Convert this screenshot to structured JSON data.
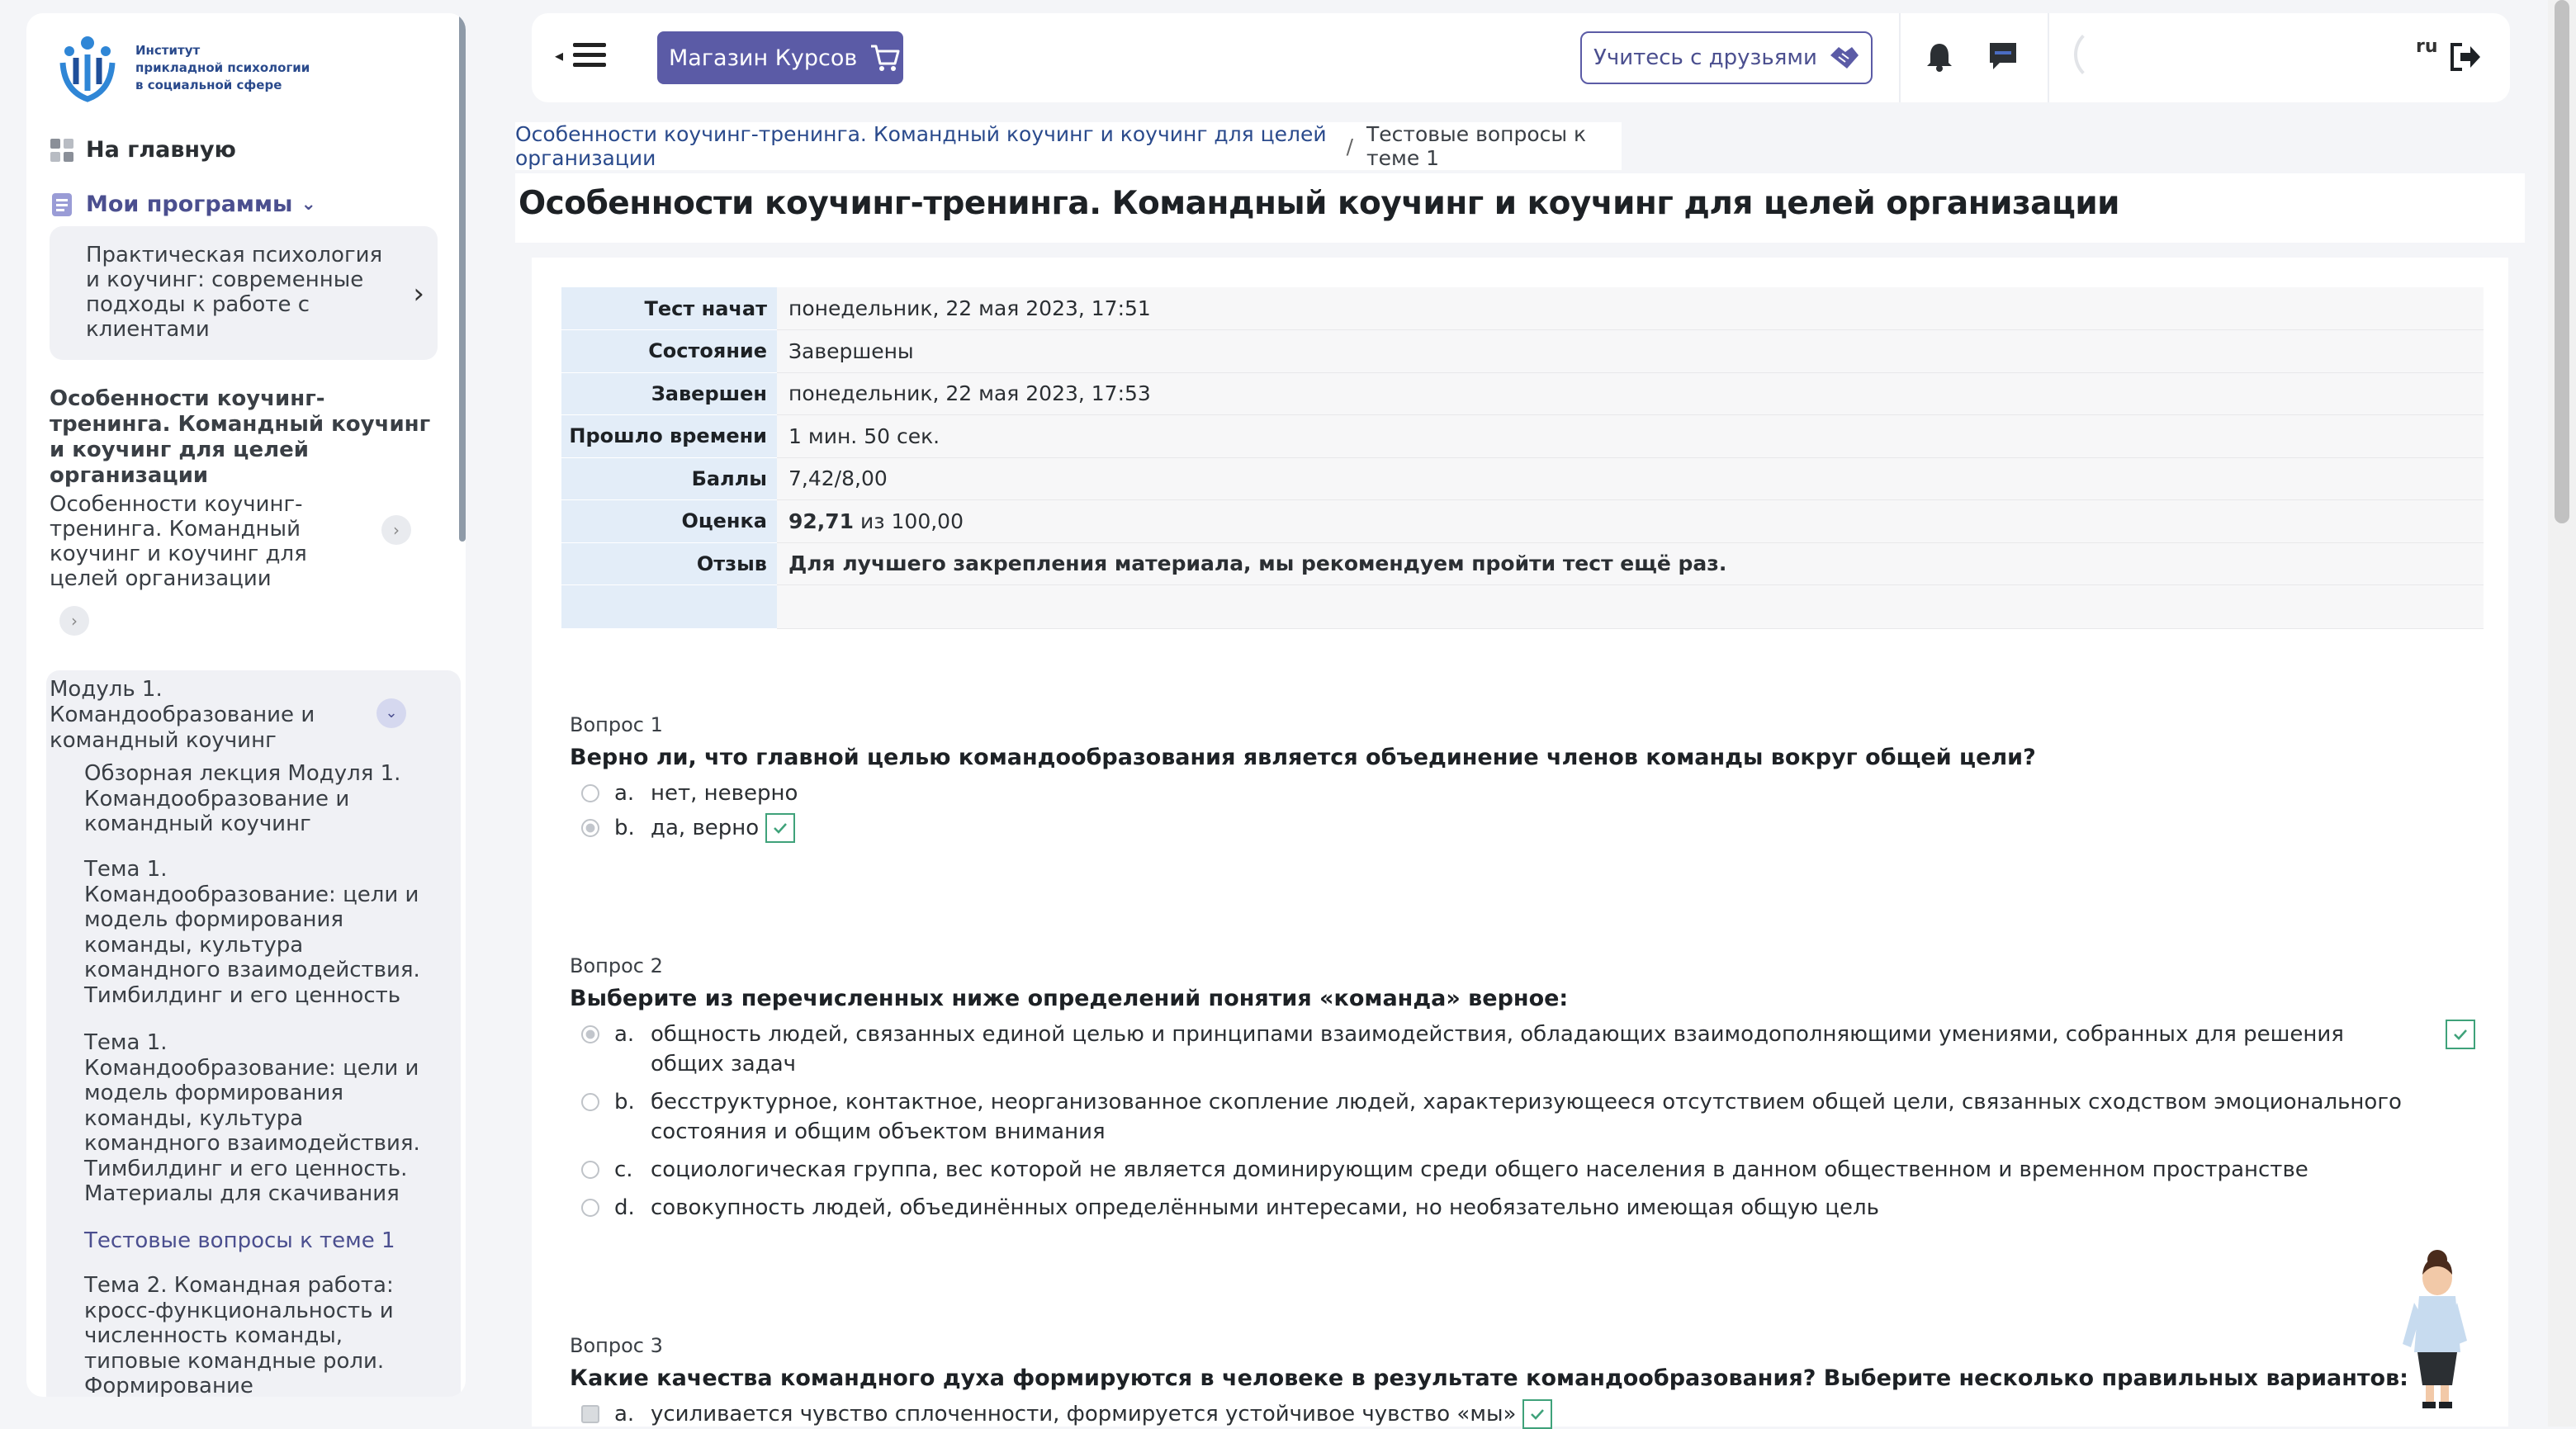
{
  "sidebar": {
    "logo_text": "Институт\nприкладной психологии\nв социальной сфере",
    "home": "На главную",
    "my_programs": "Мои программы",
    "program_card": "Практическая психология и коучинг: современные подходы к работе с клиентами",
    "course_title": "Особенности коучинг-тренинга. Командный коучинг и коучинг для целей организации",
    "course_item": "Особенности коучинг-тренинга. Командный коучинг и коучинг для целей организации",
    "module_title": "Модуль 1. Командообразование и командный коучинг",
    "module_items": [
      "Обзорная лекция Модуля 1. Командообразование и командный коучинг",
      "Тема 1. Командообразование: цели и модель формирования команды, культура командного взаимодействия. Тимбилдинг и его ценность",
      "Тема 1. Командообразование: цели и модель формирования команды, культура командного взаимодействия. Тимбилдинг и его ценность. Материалы для скачивания",
      "Тестовые вопросы к теме 1",
      "Тема 2. Командная работа: кросс-функциональность и численность команды, типовые командные роли. Формирование"
    ]
  },
  "header": {
    "shop_button": "Магазин Курсов",
    "friends_button": "Учитесь с друзьями",
    "lang_label": "ru"
  },
  "breadcrumb": {
    "link": "Особенности коучинг-тренинга. Командный коучинг и коучинг для целей организации",
    "current": "Тестовые вопросы к теме 1"
  },
  "page_title": "Особенности коучинг-тренинга. Командный коучинг и коучинг для целей организации",
  "summary": [
    {
      "label": "Тест начат",
      "value": "понедельник, 22 мая 2023, 17:51"
    },
    {
      "label": "Состояние",
      "value": "Завершены"
    },
    {
      "label": "Завершен",
      "value": "понедельник, 22 мая 2023, 17:53"
    },
    {
      "label": "Прошло времени",
      "value": "1 мин. 50 сек."
    },
    {
      "label": "Баллы",
      "value": "7,42/8,00"
    },
    {
      "label": "Оценка",
      "value_bold": "92,71",
      "value_rest": " из 100,00"
    },
    {
      "label": "Отзыв",
      "value": "Для лучшего закрепления материала, мы рекомендуем пройти тест ещё раз."
    }
  ],
  "questions": [
    {
      "number": "Вопрос 1",
      "text": "Верно ли, что главной целью командообразования является объединение членов команды вокруг общей цели?",
      "answers": [
        {
          "letter": "a.",
          "text": "нет, неверно"
        },
        {
          "letter": "b.",
          "text": "да, верно"
        }
      ]
    },
    {
      "number": "Вопрос 2",
      "text": "Выберите из перечисленных ниже определений понятия «команда» верное:",
      "answers": [
        {
          "letter": "a.",
          "text": "общность людей, связанных единой целью и принципами взаимодействия, обладающих взаимодополняющими умениями, собранных для решения общих задач"
        },
        {
          "letter": "b.",
          "text": "бесструктурное, контактное, неорганизованное скопление людей, характеризующееся отсутствием общей цели, связанных сходством эмоционального состояния и общим объектом внимания"
        },
        {
          "letter": "c.",
          "text": "социологическая группа, вес которой не является доминирующим среди общего населения в данном общественном и временном пространстве"
        },
        {
          "letter": "d.",
          "text": "совокупность людей, объединённых определёнными интересами, но необязательно имеющая общую цель"
        }
      ]
    },
    {
      "number": "Вопрос 3",
      "text": "Какие качества командного духа формируются в человеке в результате командообразования? Выберите несколько правильных вариантов:",
      "answers": [
        {
          "letter": "a.",
          "text": "усиливается чувство сплоченности, формируется устойчивое чувство «мы»"
        }
      ]
    }
  ],
  "colors": {
    "accent": "#5b5ba6",
    "correct": "#3fa27a",
    "link": "#2a4a8c"
  }
}
